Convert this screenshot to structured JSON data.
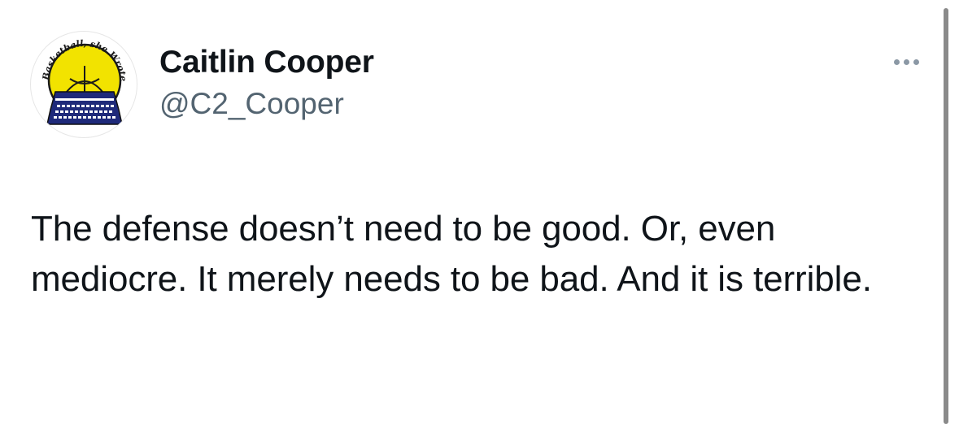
{
  "author": {
    "display_name": "Caitlin Cooper",
    "handle": "@C2_Cooper",
    "avatar_logo_text": "Basketball, she Wrote"
  },
  "tweet": {
    "text": "The defense doesn’t need to be good. Or, even mediocre. It merely needs to be bad. And it is terrible."
  },
  "menu": {
    "icon": "more-horizontal-icon"
  },
  "colors": {
    "text_primary": "#0f1419",
    "text_secondary": "#536471",
    "logo_yellow": "#f2e300",
    "logo_navy": "#1f2a7a"
  }
}
